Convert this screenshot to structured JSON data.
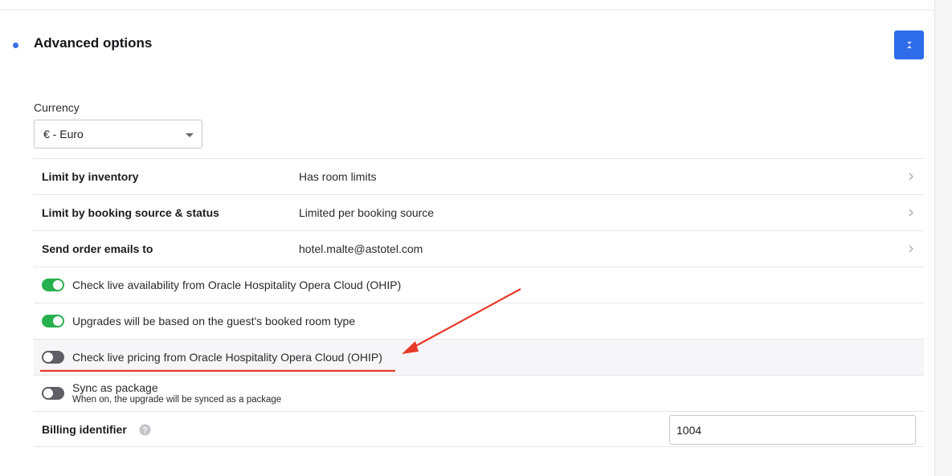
{
  "section": {
    "title": "Advanced options",
    "collapse_icon": "chevrons-collapse-icon",
    "accent_color": "#2f6cea"
  },
  "currency": {
    "label": "Currency",
    "selected": "€ - Euro"
  },
  "rows": [
    {
      "label": "Limit by inventory",
      "value": "Has room limits"
    },
    {
      "label": "Limit by booking source & status",
      "value": "Limited per booking source"
    },
    {
      "label": "Send order emails to",
      "value": "hotel.malte@astotel.com"
    }
  ],
  "toggles": [
    {
      "label": "Check live availability from Oracle Hospitality Opera Cloud (OHIP)",
      "on": true
    },
    {
      "label": "Upgrades will be based on the guest's booked room type",
      "on": true
    },
    {
      "label": "Check live pricing from Oracle Hospitality Opera Cloud (OHIP)",
      "on": false
    }
  ],
  "sync": {
    "title": "Sync as package",
    "subtitle": "When on, the upgrade will be synced as a package",
    "on": false
  },
  "billing": {
    "label": "Billing identifier",
    "value": "1004"
  },
  "colors": {
    "toggle_on": "#27b04e",
    "toggle_off": "#5e5e64",
    "annotation_red": "#e8382a"
  }
}
